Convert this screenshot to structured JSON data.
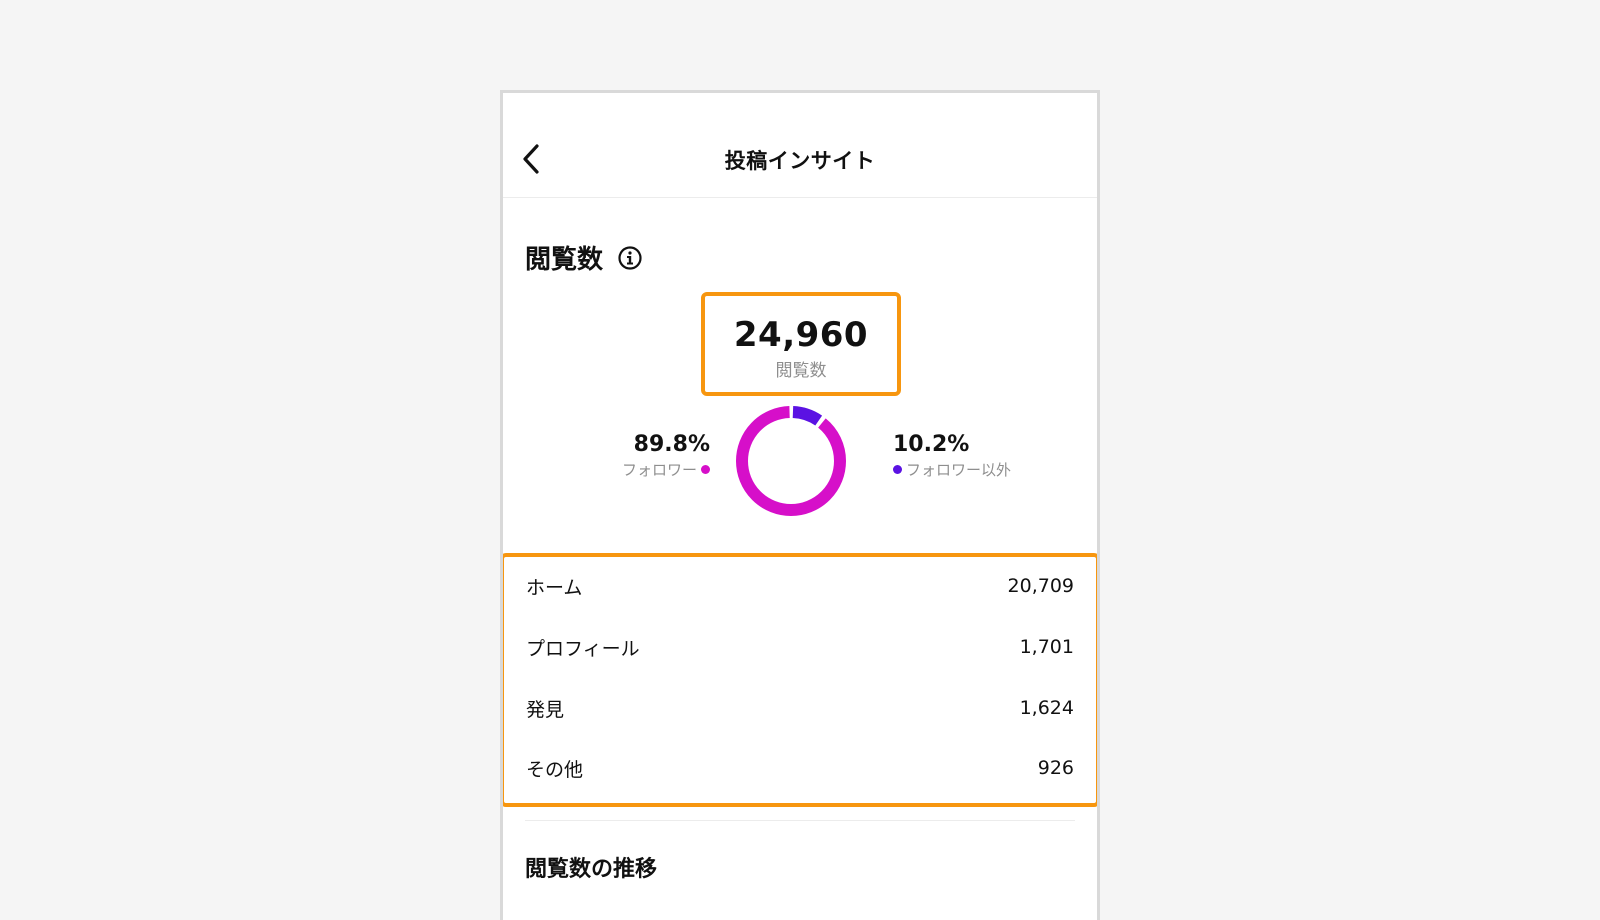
{
  "nav": {
    "title": "投稿インサイト",
    "back_icon": "chevron-left-icon"
  },
  "views_section": {
    "title": "閲覧数",
    "info_icon": "info-icon",
    "total_value": "24,960",
    "total_label": "閲覧数",
    "followers": {
      "percent": "89.8%",
      "label": "フォロワー",
      "color": "#d60fc9",
      "fraction": 0.898
    },
    "non_followers": {
      "percent": "10.2%",
      "label": "フォロワー以外",
      "color": "#5b12e3",
      "fraction": 0.102
    }
  },
  "breakdown": [
    {
      "label": "ホーム",
      "value": "20,709"
    },
    {
      "label": "プロフィール",
      "value": "1,701"
    },
    {
      "label": "発見",
      "value": "1,624"
    },
    {
      "label": "その他",
      "value": "926"
    }
  ],
  "trend_section": {
    "title": "閲覧数の推移"
  },
  "colors": {
    "highlight": "#f7960f"
  }
}
